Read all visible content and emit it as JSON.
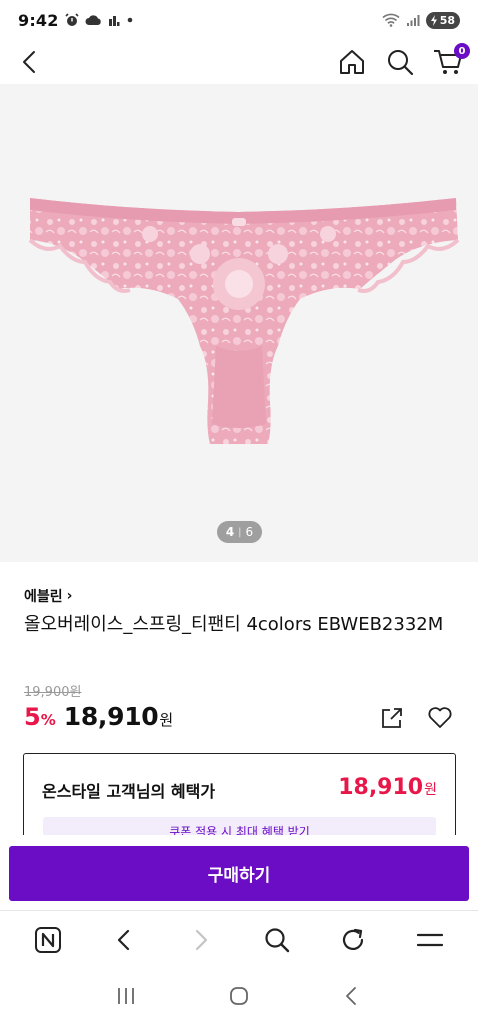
{
  "status_bar": {
    "time": "9:42",
    "battery": "58",
    "icons": [
      "alarm-icon",
      "cloud-icon",
      "sim-icon",
      "dot-icon",
      "wifi-icon",
      "signal-icon",
      "battery-icon"
    ]
  },
  "header": {
    "icons": [
      "back-icon",
      "home-icon",
      "search-icon",
      "cart-icon"
    ],
    "cart_count": "0"
  },
  "gallery": {
    "current": "4",
    "separator": "|",
    "total": "6",
    "product_color": "#ecaabb"
  },
  "product": {
    "brand": "에블린",
    "brand_chevron": "›",
    "title": "올오버레이스_스프링_티팬티 4colors EBWEB2332M",
    "original_price": "19,900원",
    "discount": "5",
    "discount_unit": "%",
    "sale_price": "18,910",
    "currency": "원",
    "action_icons": [
      "share-icon",
      "heart-icon"
    ]
  },
  "benefit": {
    "label": "온스타일 고객님의 혜택가",
    "price": "18,910",
    "currency": "원",
    "coupon_text": "쿠폰 적용 시 최대 혜택 받기"
  },
  "buy_button": {
    "label": "구매하기"
  },
  "browser_toolbar": {
    "icons": [
      "naver-icon",
      "back-arrow-icon",
      "forward-arrow-icon",
      "search-icon",
      "refresh-icon",
      "menu-icon"
    ]
  },
  "android_nav": {
    "icons": [
      "recent-apps-icon",
      "home-circle-icon",
      "back-nav-icon"
    ]
  },
  "colors": {
    "accent": "#6a0dc5",
    "sale": "#e8174a",
    "image_bg": "#f4f4f4"
  }
}
